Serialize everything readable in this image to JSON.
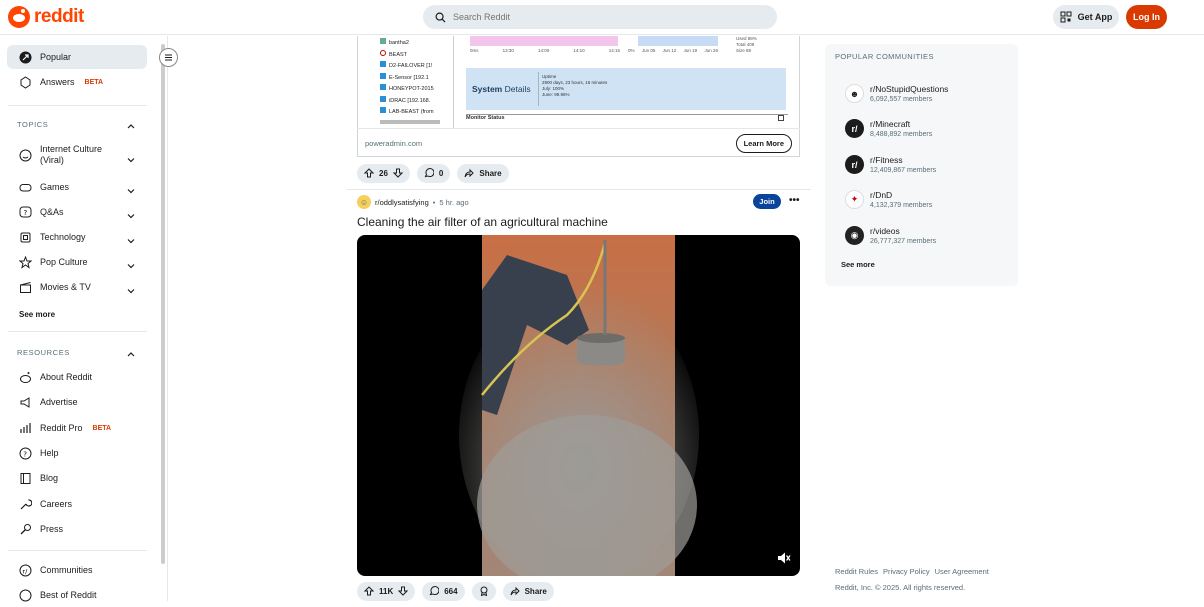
{
  "header": {
    "logo_text": "reddit",
    "search_placeholder": "Search Reddit",
    "get_app_label": "Get App",
    "login_label": "Log In"
  },
  "sidebar": {
    "top_items": [
      {
        "label": "Popular",
        "icon": "popular-icon"
      },
      {
        "label": "Answers",
        "badge": "BETA",
        "icon": "answers-icon"
      }
    ],
    "topics_heading": "TOPICS",
    "topics": [
      {
        "label_1": "Internet Culture",
        "label_2": "(Viral)",
        "icon": "smile-icon"
      },
      {
        "label": "Games",
        "icon": "gamepad-icon"
      },
      {
        "label": "Q&As",
        "icon": "question-bubble-icon"
      },
      {
        "label": "Technology",
        "icon": "chip-icon"
      },
      {
        "label": "Pop Culture",
        "icon": "star-icon"
      },
      {
        "label": "Movies & TV",
        "icon": "clapper-icon"
      }
    ],
    "topics_see_more": "See more",
    "resources_heading": "RESOURCES",
    "resources": [
      {
        "label": "About Reddit",
        "icon": "reddit-icon"
      },
      {
        "label": "Advertise",
        "icon": "megaphone-icon"
      },
      {
        "label": "Reddit Pro",
        "badge": "BETA",
        "icon": "bar-chart-icon"
      },
      {
        "label": "Help",
        "icon": "help-icon"
      },
      {
        "label": "Blog",
        "icon": "book-icon"
      },
      {
        "label": "Careers",
        "icon": "wrench-icon"
      },
      {
        "label": "Press",
        "icon": "mic-icon"
      }
    ],
    "bottom_items": [
      {
        "label": "Communities",
        "icon": "communities-icon"
      },
      {
        "label": "Best of Reddit",
        "icon": "best-icon"
      }
    ]
  },
  "embed": {
    "tree_items": [
      "bantha2",
      "BEAST",
      "D2-FAILOVER [1!",
      "E-Sensor [192.1",
      "HONEYPOT-2015",
      "iDRAC [192.168.",
      "LAB-BEAST (from"
    ],
    "system_details_bold": "System",
    "system_details_rest": "Details",
    "uptime_label": "Uptime",
    "uptime_value": "2900 days, 23 hours, 16 minutes",
    "july_value": "July: 100%",
    "june_value": "June: 99.96%",
    "monitor_status": "Monitor Status",
    "axis_left": [
      "0ms",
      "13:30",
      "14:00",
      "14:10",
      "14:15"
    ],
    "axis_right": [
      "0%",
      "Jun 05",
      "Jun 12",
      "Jun 19",
      "Jun 26"
    ],
    "legend_used": "Used",
    "legend_total": "Total",
    "legend_size": "Size",
    "legend_used_val": "88%",
    "legend_total_val": "409",
    "legend_size_val": "88",
    "source": "poweradmin.com",
    "learn_more": "Learn More",
    "upvotes": "26",
    "comments": "0",
    "share": "Share"
  },
  "post": {
    "subreddit": "r/oddlysatisfying",
    "time": "5 hr. ago",
    "join_label": "Join",
    "title": "Cleaning the air filter of an agricultural machine",
    "upvotes": "11K",
    "comments": "664",
    "share": "Share"
  },
  "right_panel": {
    "heading": "POPULAR COMMUNITIES",
    "communities": [
      {
        "name": "r/NoStupidQuestions",
        "members": "6,092,557 members"
      },
      {
        "name": "r/Minecraft",
        "members": "8,488,892 members"
      },
      {
        "name": "r/Fitness",
        "members": "12,409,867 members"
      },
      {
        "name": "r/DnD",
        "members": "4,132,379 members"
      },
      {
        "name": "r/videos",
        "members": "26,777,327 members"
      }
    ],
    "see_more": "See more"
  },
  "footer": {
    "rules": "Reddit Rules",
    "privacy": "Privacy Policy",
    "agreement": "User Agreement",
    "copyright": "Reddit, Inc. © 2025. All rights reserved."
  },
  "colors": {
    "brand": "#ff4500",
    "login_bg": "#d93a00",
    "join_bg": "#0a449b",
    "chart_pink": "#f3c5ec",
    "chart_blue": "#c7dcf4",
    "details_bg": "#cfe3f5"
  }
}
